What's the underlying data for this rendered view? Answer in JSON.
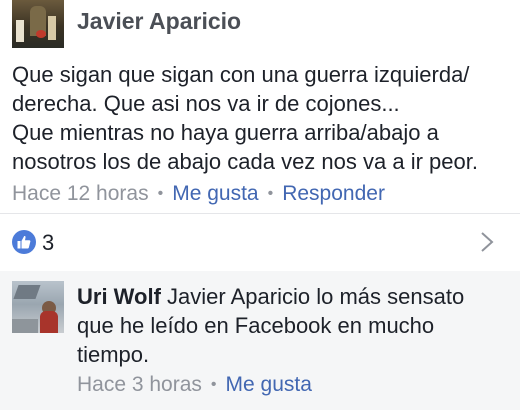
{
  "main_comment": {
    "author": "Javier Aparicio",
    "body_lines": [
      "Que sigan que sigan con una guerra izquierda/",
      "derecha. Que asi nos va ir de cojones...",
      "Que mientras no haya guerra arriba/abajo a",
      "nosotros los de abajo cada vez nos va a ir peor."
    ],
    "timestamp": "Hace 12 horas",
    "separator": "•",
    "like_label": "Me gusta",
    "reply_label": "Responder",
    "reaction_count": "3",
    "reaction_icon": "thumbs-up-icon",
    "accent_color": "#4267b2"
  },
  "reply": {
    "author": "Uri Wolf",
    "body_first": "Javier Aparicio lo más sensato",
    "body_lines": [
      "que he leído en Facebook en mucho",
      "tiempo."
    ],
    "timestamp": "Hace 3 horas",
    "separator": "•",
    "like_label": "Me gusta"
  }
}
